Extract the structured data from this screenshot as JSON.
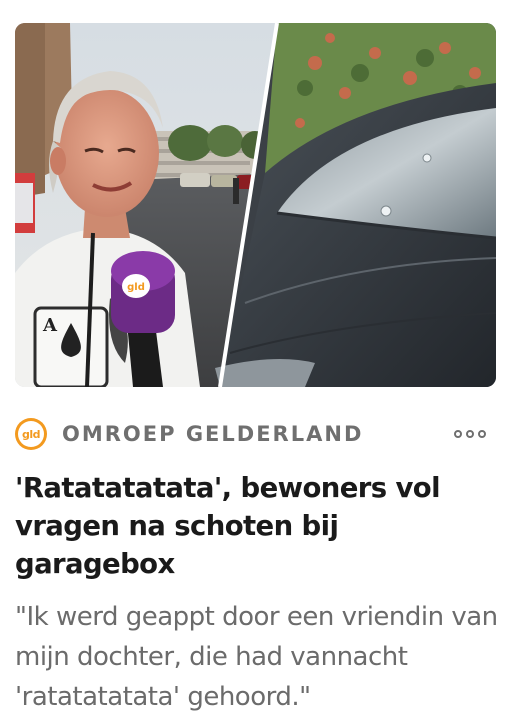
{
  "article": {
    "source": {
      "logo_text": "gld",
      "name": "OMROEP GELDERLAND"
    },
    "image": {
      "microphone_logo_text": "gld"
    },
    "headline": "'Ratatatatata', bewoners vol vragen na schoten bij garagebox",
    "summary": "\"Ik werd geappt door een vriendin van mijn dochter, die had vannacht 'ratatatatata' gehoord.\"",
    "more_icon": "more-dots-icon"
  },
  "colors": {
    "brand_orange": "#f39a1f",
    "source_gray": "#6f6f6f",
    "headline": "#1a1a1a",
    "summary": "#6b6b6b"
  }
}
